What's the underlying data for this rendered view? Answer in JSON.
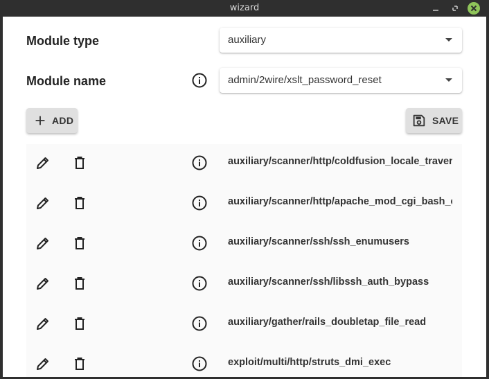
{
  "window": {
    "title": "wizard"
  },
  "form": {
    "module_type_label": "Module type",
    "module_type_value": "auxiliary",
    "module_name_label": "Module name",
    "module_name_value": "admin/2wire/xslt_password_reset"
  },
  "toolbar": {
    "add_label": "ADD",
    "save_label": "SAVE"
  },
  "modules": [
    "auxiliary/scanner/http/coldfusion_locale_traversal",
    "auxiliary/scanner/http/apache_mod_cgi_bash_env",
    "auxiliary/scanner/ssh/ssh_enumusers",
    "auxiliary/scanner/ssh/libssh_auth_bypass",
    "auxiliary/gather/rails_doubletap_file_read",
    "exploit/multi/http/struts_dmi_exec"
  ],
  "colors": {
    "close_button": "#8fc45a",
    "button_bg": "#e0e0e0",
    "titlebar": "#2f2f2f"
  }
}
